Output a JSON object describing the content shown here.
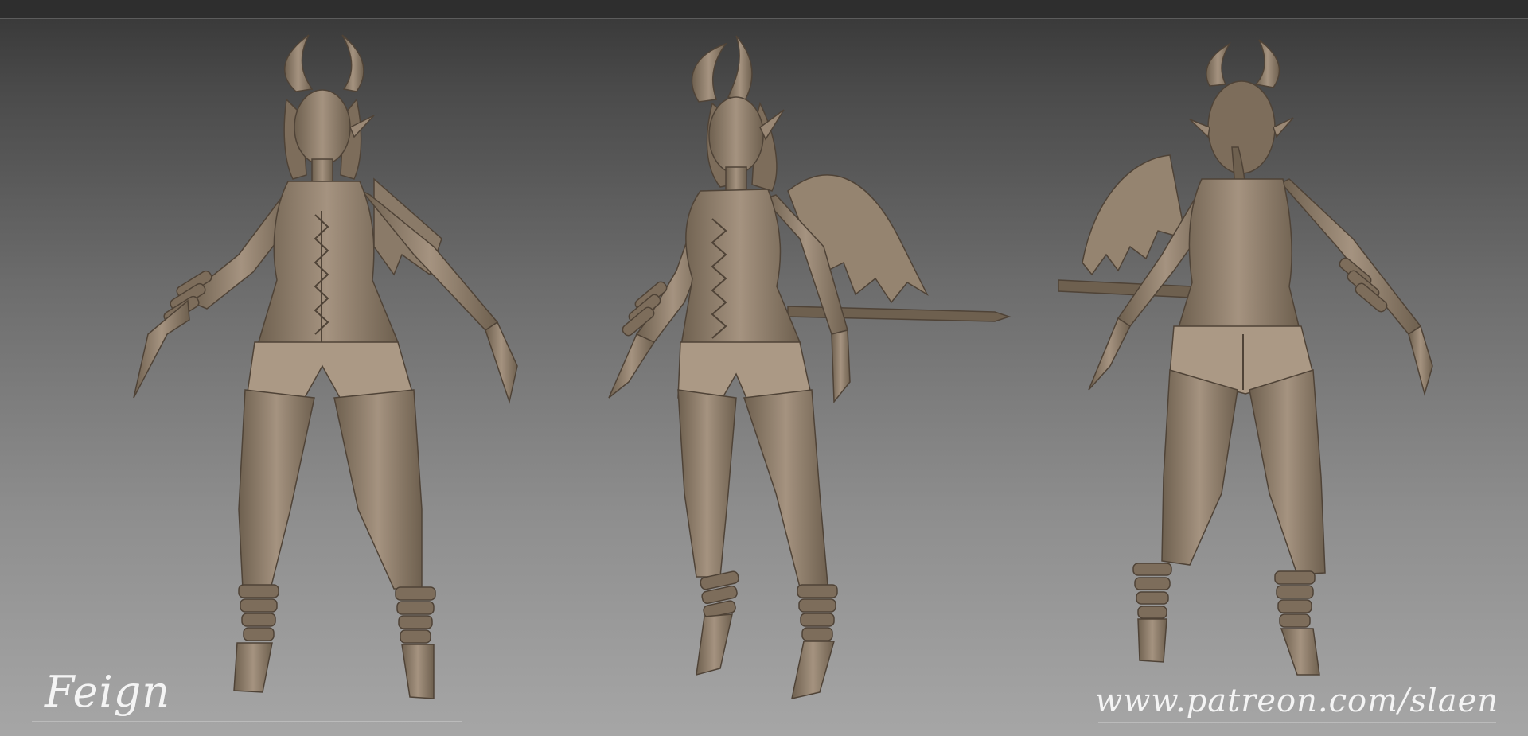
{
  "caption": {
    "character_name": "Feign",
    "url": "www.patreon.com/slaen"
  },
  "palette": {
    "clay": "#8c7b68",
    "clay_light": "#ab9985",
    "clay_dark": "#5e5042",
    "background_top": "#363636",
    "background_bottom": "#a6a6a6",
    "text": "#f4f4f4"
  }
}
